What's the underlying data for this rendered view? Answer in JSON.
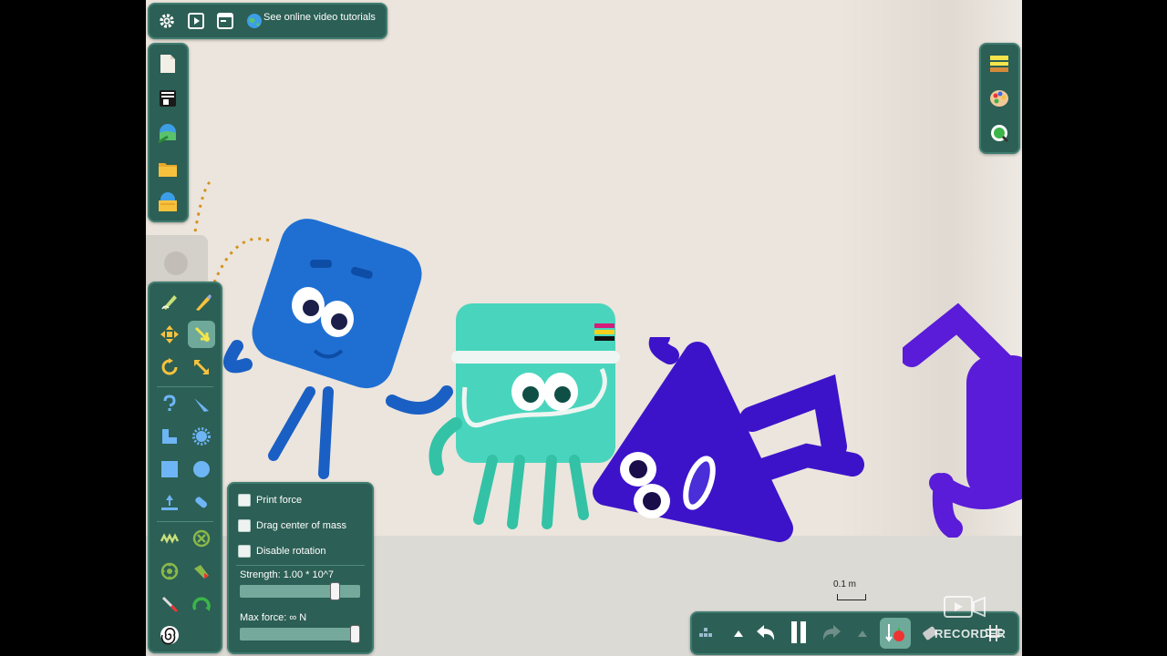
{
  "top_toolbar": {
    "tutorials_label": "See online video tutorials",
    "icons": [
      "gear-icon",
      "play-icon",
      "window-icon",
      "globe-icon"
    ]
  },
  "file_panel": {
    "icons": [
      "new-document-icon",
      "scene-menu-icon",
      "save-scene-icon",
      "open-folder-icon",
      "load-scene-icon"
    ]
  },
  "right_panel": {
    "icons": [
      "background-layers-icon",
      "palette-icon",
      "zoom-fit-icon"
    ]
  },
  "tools_panel": {
    "active_tool": "drag-tool",
    "tools": [
      "sketch-tool",
      "brush-tool",
      "move-tool",
      "drag-tool",
      "rotate-tool",
      "scale-tool",
      "chain-tool",
      "knife-tool",
      "polygon-tool",
      "gear-tool",
      "box-tool",
      "circle-tool",
      "plane-tool",
      "gravity-tool",
      "spring-tool",
      "fixate-tool",
      "hinge-tool",
      "tracer-tool",
      "laser-tool",
      "thruster-tool",
      "spiral-tool"
    ]
  },
  "drag_options": {
    "options": [
      {
        "label": "Print force",
        "checked": false
      },
      {
        "label": "Drag center of mass",
        "checked": false
      },
      {
        "label": "Disable rotation",
        "checked": false
      }
    ],
    "strength_label": "Strength:  1.00 * 10^7",
    "strength_fraction": 0.82,
    "max_force_label": "Max force:  ∞  N",
    "max_force_fraction": 1.0
  },
  "bottom_bar": {
    "icons": [
      "menu-grid-icon",
      "expand-up-icon",
      "undo-icon",
      "pause-icon",
      "redo-icon",
      "expand-up-icon-2",
      "gravity-toggle-icon",
      "eraser-icon",
      "grid-icon"
    ]
  },
  "scale_label": "0.1 m",
  "watermark": "RECORDER",
  "colors": {
    "panel": "#2c5f55",
    "accent": "#6ea99a",
    "background": "#ebe5dd",
    "blue": "#1f6fd3",
    "teal": "#49d5bd",
    "purple": "#3d13c9"
  }
}
